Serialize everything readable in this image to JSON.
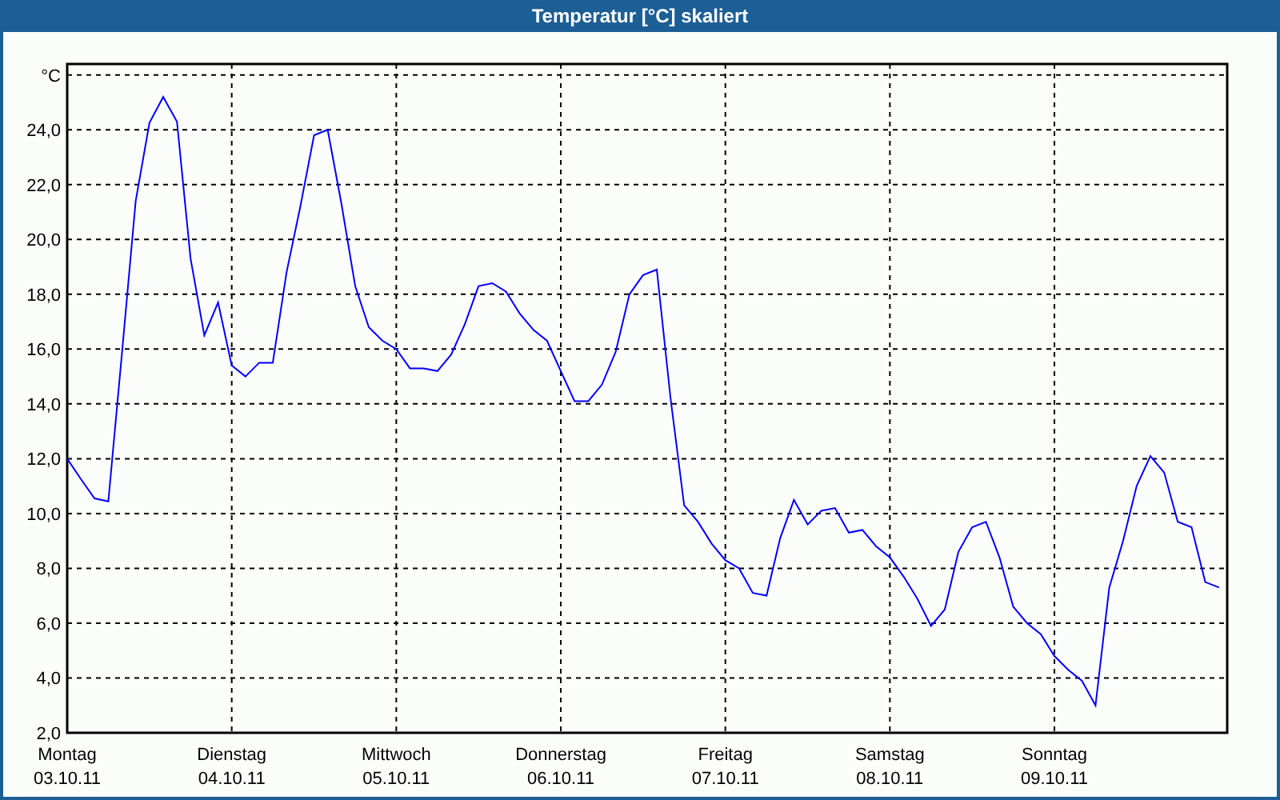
{
  "window": {
    "title": "Temperatur [°C] skaliert"
  },
  "chart": {
    "dates": [
      "03.10.11",
      "04.10.11",
      "05.10.11",
      "06.10.11",
      "07.10.11",
      "08.10.11",
      "09.10.11"
    ],
    "chart_data": {
      "type": "line",
      "grid": true,
      "ylim": [
        2,
        26.4
      ],
      "categories": [
        "Montag",
        null,
        null,
        null,
        null,
        null,
        null,
        null,
        null,
        null,
        null,
        null,
        "Dienstag",
        null,
        null,
        null,
        null,
        null,
        null,
        null,
        null,
        null,
        null,
        null,
        "Mittwoch",
        null,
        null,
        null,
        null,
        null,
        null,
        null,
        null,
        null,
        null,
        null,
        "Donnerstag",
        null,
        null,
        null,
        null,
        null,
        null,
        null,
        null,
        null,
        null,
        null,
        "Freitag",
        null,
        null,
        null,
        null,
        null,
        null,
        null,
        null,
        null,
        null,
        null,
        "Samstag",
        null,
        null,
        null,
        null,
        null,
        null,
        null,
        null,
        null,
        null,
        null,
        "Sonntag",
        null,
        null,
        null,
        null,
        null,
        null,
        null,
        null,
        null,
        null,
        null,
        null
      ],
      "yticks": [
        {
          "value": 2,
          "label": "2,0"
        },
        {
          "value": 4,
          "label": "4,0"
        },
        {
          "value": 6,
          "label": "6,0"
        },
        {
          "value": 8,
          "label": "8,0"
        },
        {
          "value": 10,
          "label": "10,0"
        },
        {
          "value": 12,
          "label": "12,0"
        },
        {
          "value": 14,
          "label": "14,0"
        },
        {
          "value": 16,
          "label": "16,0"
        },
        {
          "value": 18,
          "label": "18,0"
        },
        {
          "value": 20,
          "label": "20,0"
        },
        {
          "value": 22,
          "label": "22,0"
        },
        {
          "value": 24,
          "label": "24,0"
        },
        {
          "value": 26,
          "label": "°C"
        }
      ],
      "series": [
        {
          "color": "#0000ff",
          "values": [
            12.0,
            11.25,
            10.55,
            10.44,
            15.9,
            21.4,
            24.25,
            25.2,
            24.3,
            19.3,
            16.5,
            17.7,
            15.4,
            15.0,
            15.5,
            15.5,
            18.8,
            21.2,
            23.8,
            24.0,
            21.3,
            18.3,
            16.8,
            16.3,
            16.0,
            15.3,
            15.3,
            15.2,
            15.8,
            16.9,
            18.3,
            18.4,
            18.1,
            17.3,
            16.7,
            16.3,
            15.2,
            14.1,
            14.1,
            14.7,
            15.9,
            18.0,
            18.7,
            18.9,
            14.2,
            10.3,
            9.7,
            8.9,
            8.3,
            8.0,
            7.1,
            7.0,
            9.1,
            10.5,
            9.6,
            10.1,
            10.2,
            9.3,
            9.4,
            8.8,
            8.4,
            7.7,
            6.9,
            5.9,
            6.5,
            8.6,
            9.5,
            9.7,
            8.4,
            6.6,
            6.0,
            5.6,
            4.8,
            4.3,
            3.9,
            3.0,
            7.3,
            9.0,
            11.0,
            12.1,
            11.5,
            9.7,
            9.5,
            7.5,
            7.3
          ]
        }
      ]
    }
  }
}
